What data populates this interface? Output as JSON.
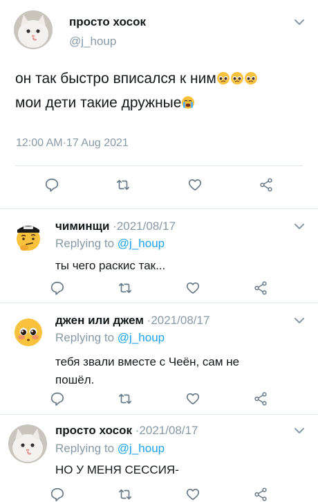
{
  "main_tweet": {
    "display_name": "просто хосок",
    "handle": "@j_houp",
    "text_line1": "он так быстро вписался к ним",
    "text_line2": "мои дети такие дружные",
    "timestamp": "12:00 AM·17 Aug 2021"
  },
  "replies": [
    {
      "display_name": "чиминщи",
      "date": "·2021/08/17",
      "replying_label": "Replying to",
      "replying_handle": "@j_houp",
      "text": "ты чего раскис так..."
    },
    {
      "display_name": "джен или джем",
      "date": "·2021/08/17",
      "replying_label": "Replying to",
      "replying_handle": "@j_houp",
      "text_line1": "тебя звали вместе с Чеён, сам не",
      "text_line2": "пошёл."
    },
    {
      "display_name": "просто хосок",
      "date": "·2021/08/17",
      "replying_label": "Replying to",
      "replying_handle": "@j_houp",
      "text": "НО У МЕНЯ СЕССИЯ-"
    }
  ],
  "colors": {
    "link": "#1da1f2",
    "muted": "#8899a6",
    "divider": "#e1e8ed",
    "icon": "#657786"
  },
  "icons": [
    "chevron-down-icon",
    "reply-icon",
    "retweet-icon",
    "like-icon",
    "share-icon",
    "pleading-face-emoji",
    "crying-face-emoji"
  ]
}
